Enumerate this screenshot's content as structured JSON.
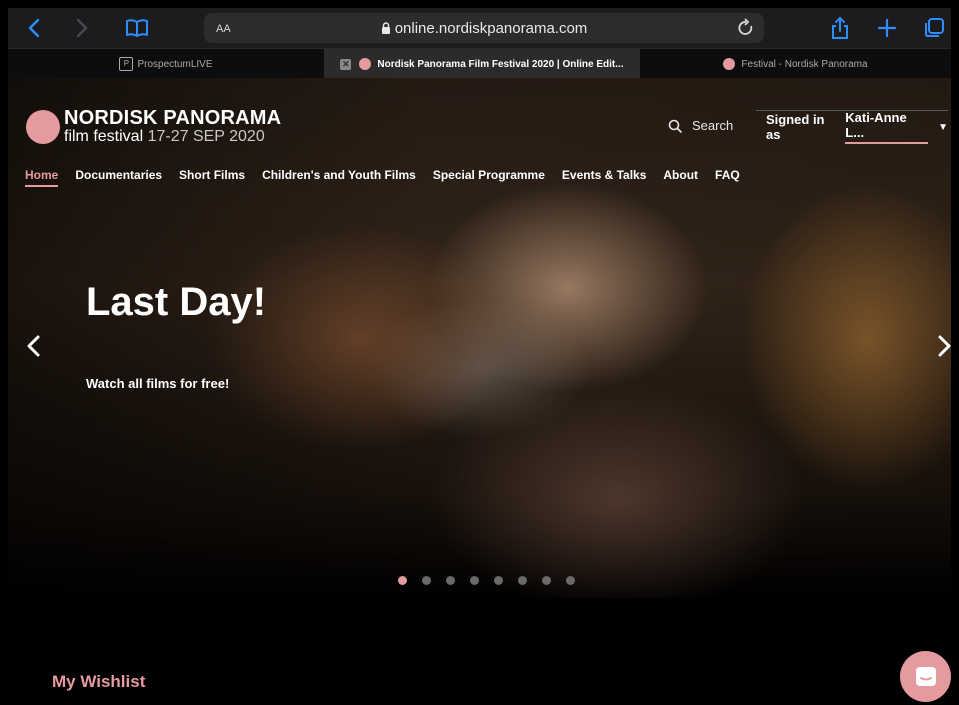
{
  "browser": {
    "address_aa": "AA",
    "url": "online.nordiskpanorama.com",
    "tabs": [
      {
        "label": "ProspectumLIVE"
      },
      {
        "label": "Nordisk Panorama Film Festival 2020 | Online Edit..."
      },
      {
        "label": "Festival - Nordisk Panorama"
      }
    ]
  },
  "site": {
    "logo_title": "NORDISK PANORAMA",
    "logo_sub": "film festival",
    "logo_dates": "17-27 SEP 2020",
    "search_label": "Search",
    "signed_in_prefix": "Signed in as",
    "signed_in_user": "Kati-Anne L...",
    "nav": [
      {
        "label": "Home"
      },
      {
        "label": "Documentaries"
      },
      {
        "label": "Short Films"
      },
      {
        "label": "Children's and Youth Films"
      },
      {
        "label": "Special Programme"
      },
      {
        "label": "Events & Talks"
      },
      {
        "label": "About"
      },
      {
        "label": "FAQ"
      }
    ],
    "hero": {
      "headline": "Last Day!",
      "subline": "Watch all films for free!"
    },
    "wishlist": "My Wishlist"
  },
  "colors": {
    "accent": "#e59aa0",
    "browser_blue": "#2f8cff",
    "toolbar_bg": "#1c1c1e"
  }
}
